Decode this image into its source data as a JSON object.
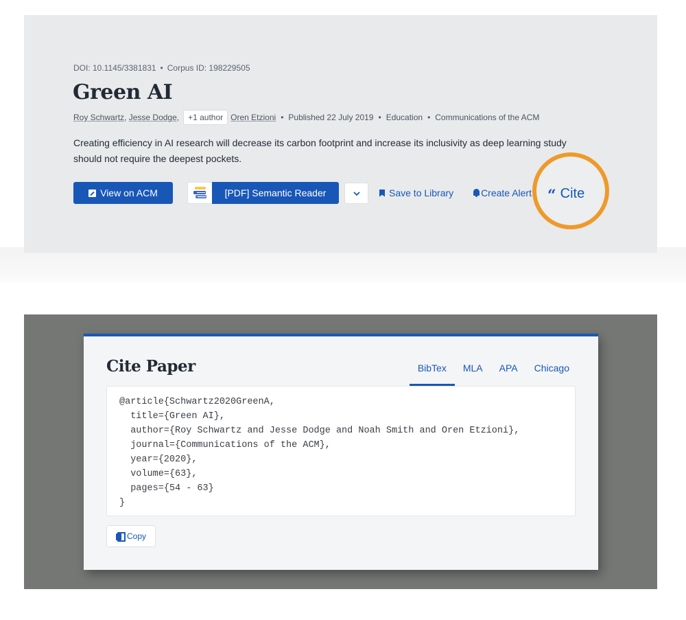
{
  "paper": {
    "doi": "DOI: 10.1145/3381831",
    "corpus_id": "Corpus ID: 198229505",
    "separator": "•",
    "title": "Green AI",
    "authors": [
      "Roy Schwartz",
      "Jesse Dodge",
      "Oren Etzioni"
    ],
    "author_sep": ",",
    "more_authors": "+1 author",
    "published": "Published 22 July 2019",
    "field": "Education",
    "venue": "Communications of the ACM",
    "tldr": "Creating efficiency in AI research will decrease its carbon footprint and increase its inclusivity as deep learning study should not require the deepest pockets."
  },
  "actions": {
    "view_on": "View on ACM",
    "reader": "[PDF] Semantic Reader",
    "save": "Save to Library",
    "alert": "Create Alert",
    "cite": "Cite",
    "highlight_color": "#ee9a2b",
    "accent_color": "#1857b6"
  },
  "cite_modal": {
    "title": "Cite Paper",
    "tabs": [
      {
        "label": "BibTex",
        "active": true
      },
      {
        "label": "MLA",
        "active": false
      },
      {
        "label": "APA",
        "active": false
      },
      {
        "label": "Chicago",
        "active": false
      }
    ],
    "bibtex_lines": [
      "@article{Schwartz2020GreenA,",
      "  title={Green AI},",
      "  author={Roy Schwartz and Jesse Dodge and Noah Smith and Oren Etzioni},",
      "  journal={Communications of the ACM},",
      "  year={2020},",
      "  volume={63},",
      "  pages={54 - 63}",
      "}"
    ],
    "copy_label": "Copy"
  }
}
